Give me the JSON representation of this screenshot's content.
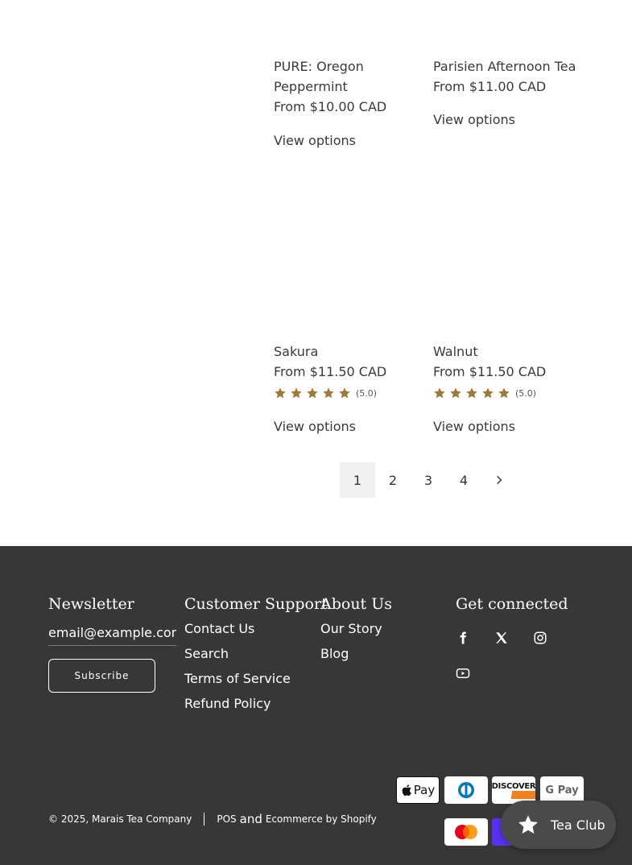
{
  "products": [
    {
      "title": "PURE: Oregon Peppermint",
      "price": "From $10.00 CAD",
      "cta": "View options"
    },
    {
      "title": "Parisien Afternoon Tea",
      "price": "From $11.00 CAD",
      "cta": "View options"
    },
    {
      "title": "Sakura",
      "price": "From $11.50 CAD",
      "rating": "(5.0)",
      "cta": "View options"
    },
    {
      "title": "Walnut",
      "price": "From $11.50 CAD",
      "rating": "(5.0)",
      "cta": "View options"
    }
  ],
  "pagination": {
    "pages": [
      "1",
      "2",
      "3",
      "4"
    ],
    "current": "1"
  },
  "footer": {
    "newsletter": {
      "heading": "Newsletter",
      "placeholder": "email@example.com",
      "button": "Subscribe"
    },
    "support": {
      "heading": "Customer Support",
      "links": [
        "Contact Us",
        "Search",
        "Terms of Service",
        "Refund Policy"
      ]
    },
    "about": {
      "heading": "About Us",
      "links": [
        "Our Story",
        "Blog"
      ]
    },
    "connect": {
      "heading": "Get connected"
    },
    "copyright": {
      "prefix": "© 2025,",
      "company": "Marais Tea Company",
      "pos": "POS",
      "and": "and",
      "ecommerce": "Ecommerce by Shopify"
    },
    "payments": {
      "apple": "Pay",
      "diners": "",
      "discover": "DISCOVER",
      "google": "G Pay",
      "shop": "S"
    }
  },
  "tea_club": {
    "label": "Tea Club"
  },
  "colors": {
    "star": "#9c7b3c",
    "footer_bg": "#373737"
  }
}
